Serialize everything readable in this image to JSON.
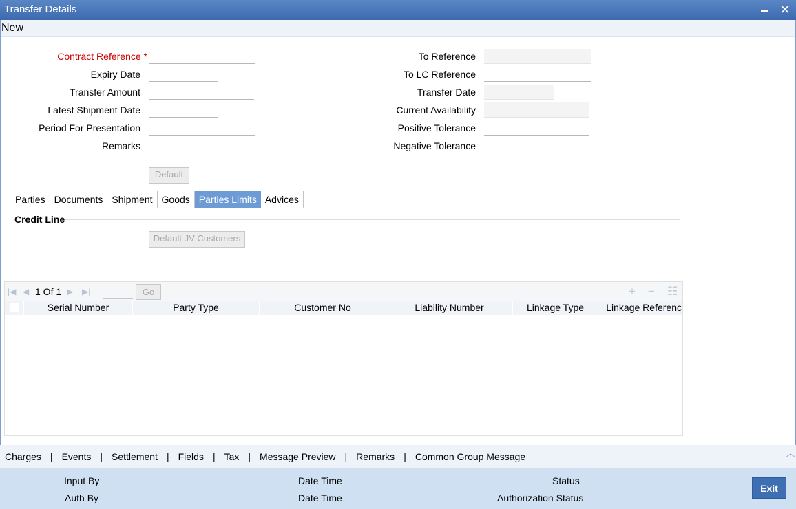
{
  "window": {
    "title": "Transfer Details"
  },
  "menu": {
    "new_label": "New"
  },
  "form": {
    "contract_reference_label": "Contract Reference",
    "required_marker": "*",
    "expiry_date_label": "Expiry Date",
    "transfer_amount_label": "Transfer Amount",
    "latest_shipment_date_label": "Latest Shipment Date",
    "period_for_presentation_label": "Period For Presentation",
    "remarks_label": "Remarks",
    "to_reference_label": "To Reference",
    "to_lc_reference_label": "To LC Reference",
    "transfer_date_label": "Transfer Date",
    "current_availability_label": "Current Availability",
    "positive_tolerance_label": "Positive Tolerance",
    "negative_tolerance_label": "Negative Tolerance",
    "default_button": "Default"
  },
  "tabs": [
    "Parties",
    "Documents",
    "Shipment",
    "Goods",
    "Parties Limits",
    "Advices"
  ],
  "active_tab": "Parties Limits",
  "section": {
    "title": "Credit Line",
    "default_jv_button": "Default JV Customers"
  },
  "grid": {
    "pager_text": "1 Of 1",
    "go_label": "Go",
    "columns": [
      "Serial Number",
      "Party Type",
      "Customer No",
      "Liability Number",
      "Linkage Type",
      "Linkage Referenc"
    ]
  },
  "bottom_nav": [
    "Charges",
    "Events",
    "Settlement",
    "Fields",
    "Tax",
    "Message Preview",
    "Remarks",
    "Common Group Message"
  ],
  "footer": {
    "input_by_label": "Input By",
    "date_time_label_1": "Date Time",
    "status_label": "Status",
    "auth_by_label": "Auth By",
    "date_time_label_2": "Date Time",
    "authorization_status_label": "Authorization Status",
    "exit_label": "Exit"
  },
  "colors": {
    "title_bar": "#3c6aaf",
    "active_tab": "#6c9bd6",
    "required": "#cc0000",
    "footer_bg": "#d0e0f3",
    "exit_button": "#3f6fb3"
  }
}
